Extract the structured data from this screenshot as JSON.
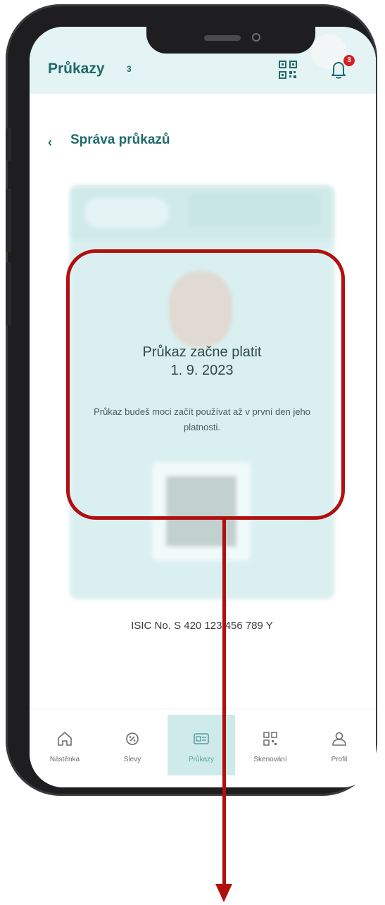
{
  "header": {
    "title": "Průkazy",
    "count": "3",
    "notification_count": "3",
    "icons": {
      "qr": "qr-code-icon",
      "bell": "bell-icon"
    }
  },
  "subheader": {
    "back_symbol": "‹",
    "title": "Správa průkazů"
  },
  "card_message": {
    "title": "Průkaz začne platit",
    "date": "1. 9. 2023",
    "body": "Průkaz budeš moci začít používat až v první den jeho platnosti."
  },
  "isic": "ISIC No.  S 420 123 456 789 Y",
  "nav": {
    "items": [
      {
        "label": "Nástěnka",
        "icon": "home-icon"
      },
      {
        "label": "Slevy",
        "icon": "discount-icon"
      },
      {
        "label": "Průkazy",
        "icon": "id-card-icon",
        "active": true
      },
      {
        "label": "Skenování",
        "icon": "qr-scan-icon"
      },
      {
        "label": "Profil",
        "icon": "user-icon"
      }
    ]
  },
  "colors": {
    "accent": "#206a6a",
    "header_bg": "#e4f3f3",
    "card_bg": "#cde8e8",
    "annotation": "#b20f0f",
    "badge": "#d42020"
  }
}
